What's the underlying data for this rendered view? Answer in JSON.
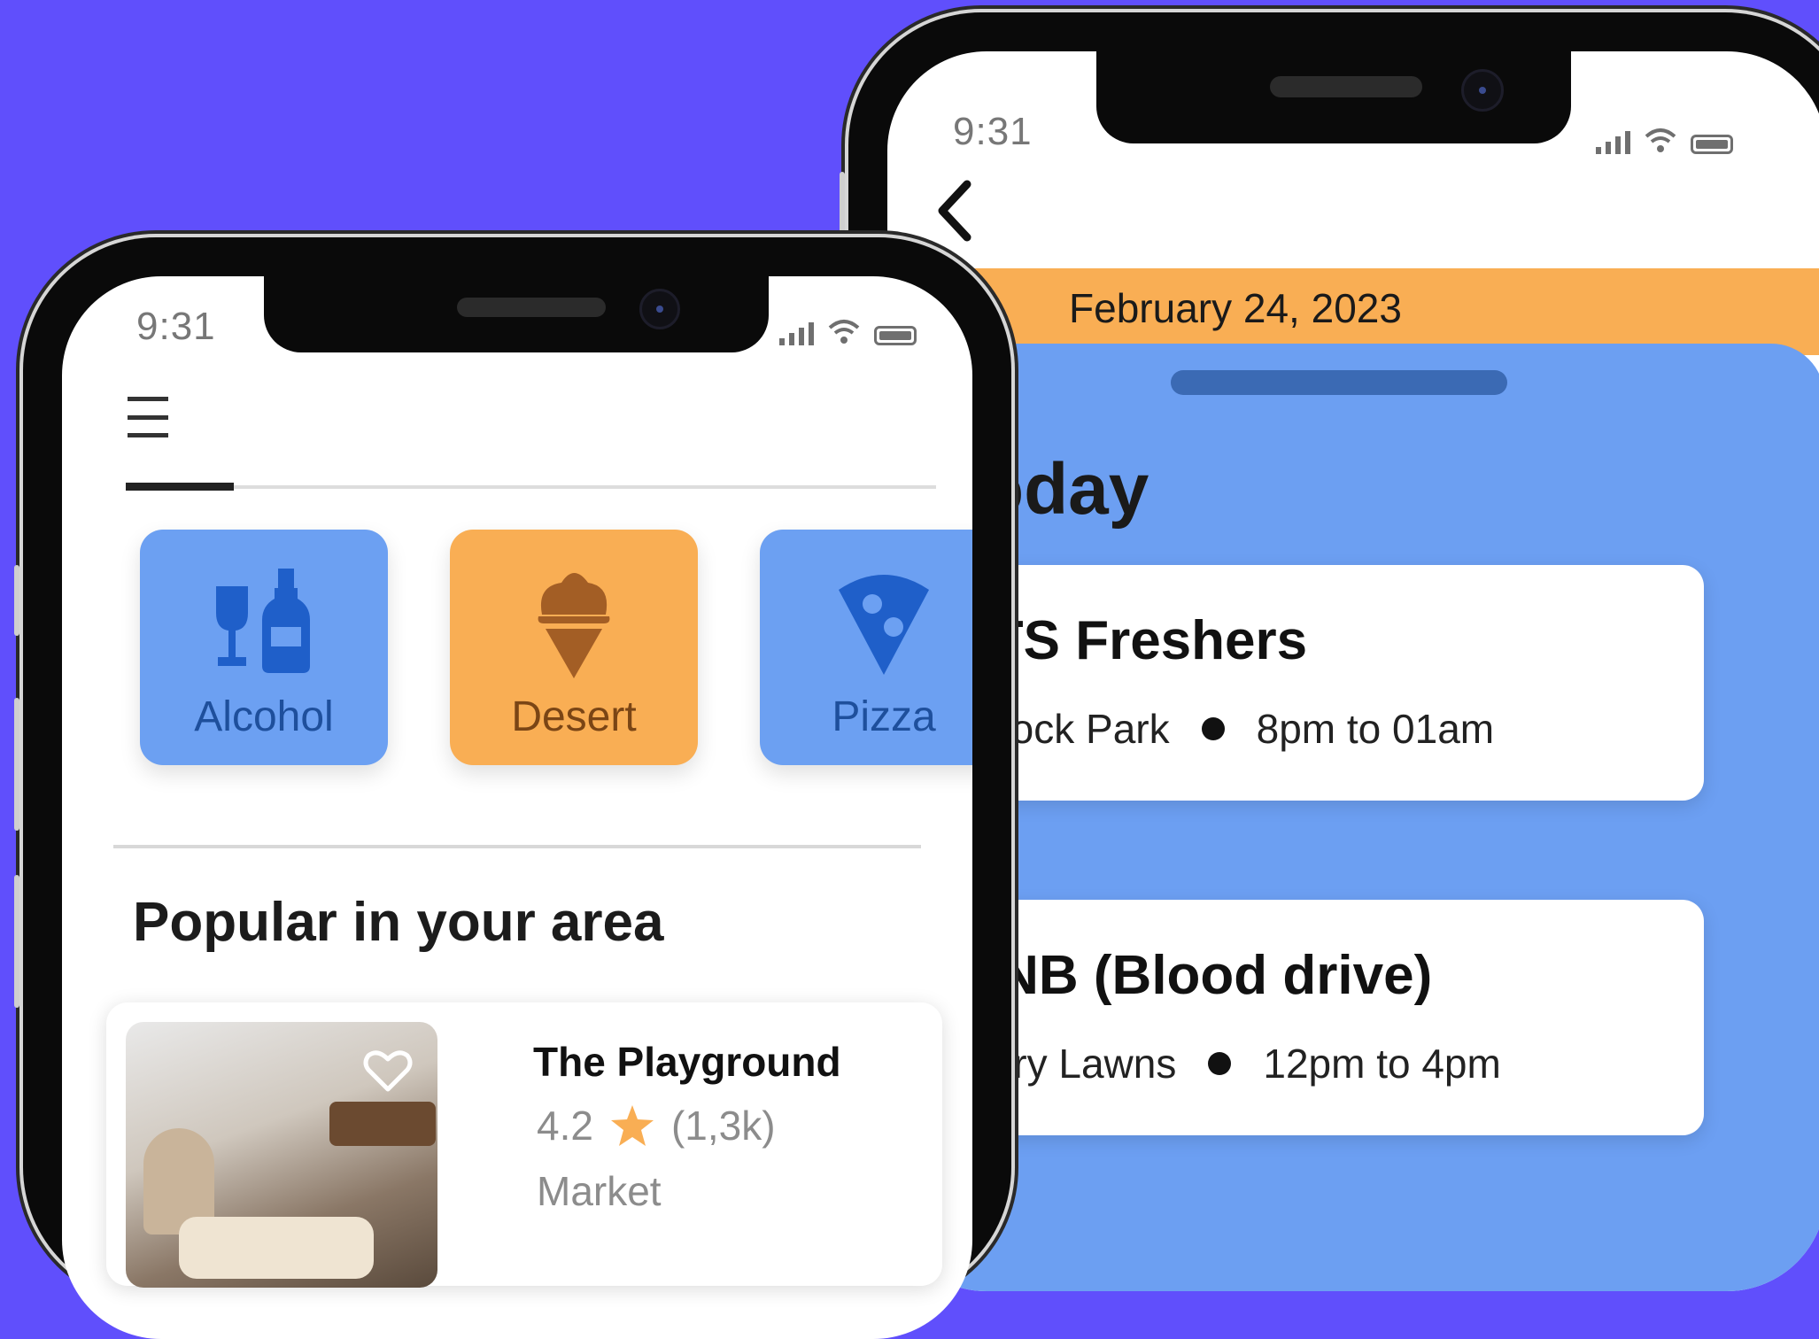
{
  "phone_left": {
    "status_time": "9:31",
    "categories": [
      {
        "label": "Alcohol",
        "icon": "wine-bottle-icon"
      },
      {
        "label": "Desert",
        "icon": "ice-cream-icon"
      },
      {
        "label": "Pizza",
        "icon": "pizza-slice-icon"
      }
    ],
    "section_title": "Popular in your area",
    "featured": {
      "name": "The Playground",
      "rating": "4.2",
      "review_count": "(1,3k)",
      "type": "Market"
    }
  },
  "phone_right": {
    "status_time": "9:31",
    "date": "February 24, 2023",
    "sheet_title": "Today",
    "events": [
      {
        "name": "WITS Freshers",
        "location": "Sturrock Park",
        "time": "8pm to 01am"
      },
      {
        "name": "SANB (Blood drive)",
        "location": "Library Lawns",
        "time": "12pm to 4pm"
      }
    ]
  },
  "colors": {
    "background": "#604ffc",
    "card_blue": "#6ca0f2",
    "card_orange": "#f9ae54",
    "rating_star": "#f9ae54"
  }
}
